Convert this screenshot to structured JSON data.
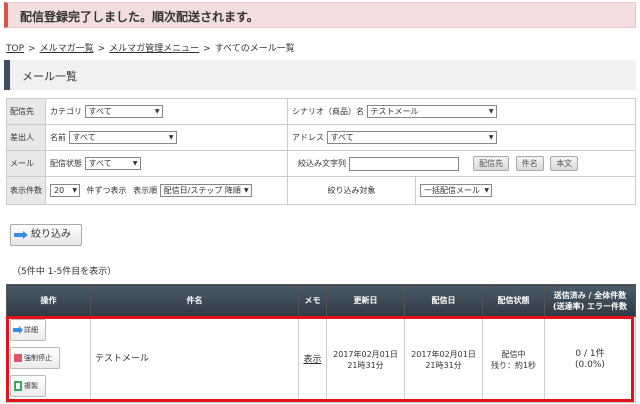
{
  "alert": {
    "message": "配信登録完了しました。順次配送されます。"
  },
  "breadcrumb": {
    "items": [
      "TOP",
      "メルマガ一覧",
      "メルマガ管理メニュー",
      "すべてのメール一覧"
    ],
    "separator": ">"
  },
  "section": {
    "title": "メール一覧"
  },
  "filter": {
    "sender_label": "配信先",
    "category_label": "カテゴリ",
    "category_value": "すべて",
    "scenario_label": "シナリオ（商品）名",
    "scenario_value": "テストメール",
    "from_label": "差出人",
    "name_label": "名前",
    "name_value": "すべて",
    "address_label": "アドレス",
    "address_value": "すべて",
    "mail_label": "メール",
    "status_label": "配信状態",
    "status_value": "すべて",
    "keyword_label": "絞込み文字列",
    "keyword_value": "",
    "btn_dest": "配信先",
    "btn_subject": "件名",
    "btn_body": "本文",
    "display_label": "表示件数",
    "display_value": "20",
    "per_page_suffix": "件ずつ表示",
    "order_label": "表示順",
    "order_value": "配信日/ステップ 降順",
    "target_label": "絞り込み対象",
    "target_value": "一括配信メール"
  },
  "filter_button": {
    "label": "絞り込み"
  },
  "result_count": "（5件中 1-5件目を表示）",
  "table": {
    "headers": [
      "操作",
      "件名",
      "メモ",
      "更新日",
      "配信日",
      "配信状態",
      "送信済み / 全体件数\n(送達率) エラー件数"
    ],
    "rows": [
      {
        "op_detail": "詳細",
        "op_stop": "強制停止",
        "op_copy": "複製",
        "subject": "テストメール",
        "memo": "表示",
        "updated_date": "2017年02月01日",
        "updated_time": "21時31分",
        "sent_date": "2017年02月01日",
        "sent_time": "21時31分",
        "status": "配信中",
        "remaining": "残り：約1秒",
        "sent_ratio": "0 / 1件",
        "delivery_rate": "(0.0%)"
      }
    ]
  },
  "colors": {
    "accent_dark": "#3e5060",
    "alert_red": "#d9534f",
    "highlight": "#e3111a"
  }
}
